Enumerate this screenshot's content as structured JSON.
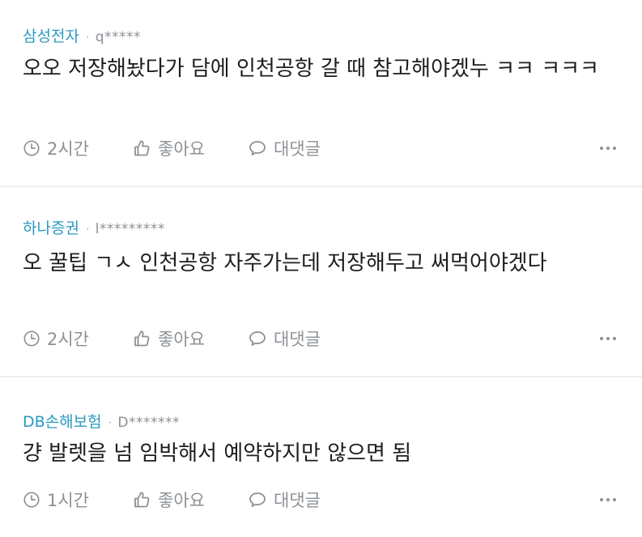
{
  "comments": [
    {
      "company": "삼성전자",
      "separator": "·",
      "user_id": "q*****",
      "text": "오오 저장해놨다가 담에 인천공항 갈 때 참고해야겠누 ㅋㅋ ㅋㅋㅋ",
      "time": "2시간",
      "like_label": "좋아요",
      "reply_label": "대댓글",
      "more_icon": "more-horizontal-icon"
    },
    {
      "company": "하나증권",
      "separator": "·",
      "user_id": "l*********",
      "text": "오 꿀팁 ㄱㅅ 인천공항 자주가는데 저장해두고 써먹어야겠다",
      "time": "2시간",
      "like_label": "좋아요",
      "reply_label": "대댓글",
      "more_icon": "more-horizontal-icon"
    },
    {
      "company": "DB손해보험",
      "separator": "·",
      "user_id": "D*******",
      "text": "걍 발렛을 넘 임박해서 예약하지만 않으면 됨",
      "time": "1시간",
      "like_label": "좋아요",
      "reply_label": "대댓글",
      "more_icon": "more-horizontal-icon"
    }
  ],
  "colors": {
    "company": "#2a9ac0",
    "muted": "#8c9196",
    "divider": "#eceef1",
    "text": "#1d1d1d"
  }
}
